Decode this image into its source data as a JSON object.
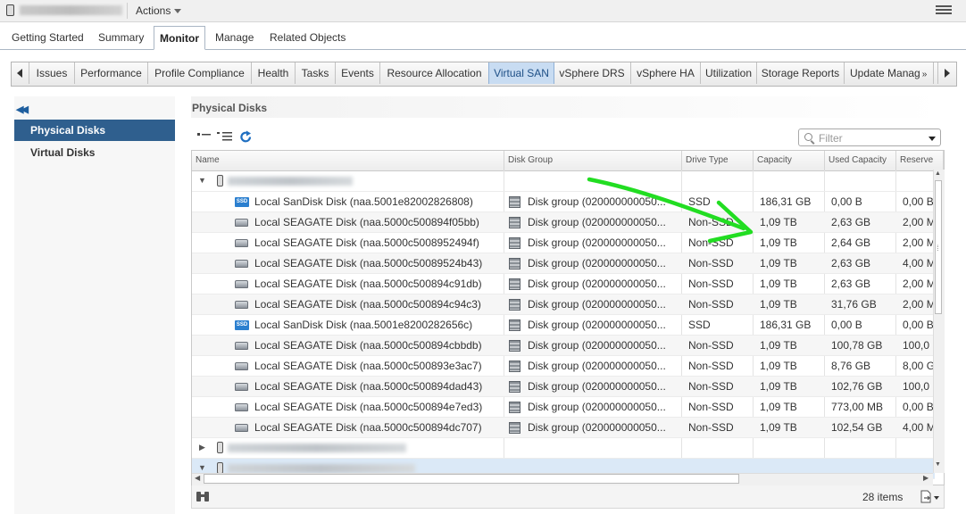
{
  "topbar": {
    "actions_label": "Actions"
  },
  "main_tabs": [
    "Getting Started",
    "Summary",
    "Monitor",
    "Manage",
    "Related Objects"
  ],
  "sub_tabs": [
    "Issues",
    "Performance",
    "Profile Compliance",
    "Health",
    "Tasks",
    "Events",
    "Resource Allocation",
    "Virtual SAN",
    "vSphere DRS",
    "vSphere HA",
    "Utilization",
    "Storage Reports",
    "Update Manag"
  ],
  "sub_tabs_active": "Virtual SAN",
  "left_nav": {
    "items": [
      "Physical Disks",
      "Virtual Disks"
    ],
    "active": "Physical Disks"
  },
  "content": {
    "title": "Physical Disks",
    "filter_placeholder": "Filter",
    "columns": [
      "Name",
      "Disk Group",
      "Drive Type",
      "Capacity",
      "Used Capacity",
      "Reserve"
    ],
    "rows": [
      {
        "name": "Local SanDisk Disk (naa.5001e82002826808)",
        "disk_group": "Disk group (020000000050...",
        "drive_type": "SSD",
        "capacity": "186,31 GB",
        "used": "0,00 B",
        "reserve": "0,00 B",
        "icon": "ssd-icon"
      },
      {
        "name": "Local SEAGATE Disk (naa.5000c500894f05bb)",
        "disk_group": "Disk group (020000000050...",
        "drive_type": "Non-SSD",
        "capacity": "1,09 TB",
        "used": "2,63 GB",
        "reserve": "2,00 M",
        "icon": "hdd-icon"
      },
      {
        "name": "Local SEAGATE Disk (naa.5000c5008952494f)",
        "disk_group": "Disk group (020000000050...",
        "drive_type": "Non-SSD",
        "capacity": "1,09 TB",
        "used": "2,64 GB",
        "reserve": "2,00 M",
        "icon": "hdd-icon"
      },
      {
        "name": "Local SEAGATE Disk (naa.5000c50089524b43)",
        "disk_group": "Disk group (020000000050...",
        "drive_type": "Non-SSD",
        "capacity": "1,09 TB",
        "used": "2,63 GB",
        "reserve": "4,00 M",
        "icon": "hdd-icon"
      },
      {
        "name": "Local SEAGATE Disk (naa.5000c500894c91db)",
        "disk_group": "Disk group (020000000050...",
        "drive_type": "Non-SSD",
        "capacity": "1,09 TB",
        "used": "2,63 GB",
        "reserve": "2,00 M",
        "icon": "hdd-icon"
      },
      {
        "name": "Local SEAGATE Disk (naa.5000c500894c94c3)",
        "disk_group": "Disk group (020000000050...",
        "drive_type": "Non-SSD",
        "capacity": "1,09 TB",
        "used": "31,76 GB",
        "reserve": "2,00 M",
        "icon": "hdd-icon"
      },
      {
        "name": "Local SanDisk Disk (naa.5001e8200282656c)",
        "disk_group": "Disk group (020000000050...",
        "drive_type": "SSD",
        "capacity": "186,31 GB",
        "used": "0,00 B",
        "reserve": "0,00 B",
        "icon": "ssd-icon"
      },
      {
        "name": "Local SEAGATE Disk (naa.5000c500894cbbdb)",
        "disk_group": "Disk group (020000000050...",
        "drive_type": "Non-SSD",
        "capacity": "1,09 TB",
        "used": "100,78 GB",
        "reserve": "100,0",
        "icon": "hdd-icon"
      },
      {
        "name": "Local SEAGATE Disk (naa.5000c500893e3ac7)",
        "disk_group": "Disk group (020000000050...",
        "drive_type": "Non-SSD",
        "capacity": "1,09 TB",
        "used": "8,76 GB",
        "reserve": "8,00 G",
        "icon": "hdd-icon"
      },
      {
        "name": "Local SEAGATE Disk (naa.5000c500894dad43)",
        "disk_group": "Disk group (020000000050...",
        "drive_type": "Non-SSD",
        "capacity": "1,09 TB",
        "used": "102,76 GB",
        "reserve": "100,0",
        "icon": "hdd-icon"
      },
      {
        "name": "Local SEAGATE Disk (naa.5000c500894e7ed3)",
        "disk_group": "Disk group (020000000050...",
        "drive_type": "Non-SSD",
        "capacity": "1,09 TB",
        "used": "773,00 MB",
        "reserve": "0,00 B",
        "icon": "hdd-icon"
      },
      {
        "name": "Local SEAGATE Disk (naa.5000c500894dc707)",
        "disk_group": "Disk group (020000000050...",
        "drive_type": "Non-SSD",
        "capacity": "1,09 TB",
        "used": "102,54 GB",
        "reserve": "4,00 M",
        "icon": "hdd-icon"
      }
    ],
    "items_count": "28 items"
  },
  "colors": {
    "accent": "#2f5f8e",
    "active_subtab": "#c8dcf2",
    "annotation_arrow": "#22dd22"
  }
}
